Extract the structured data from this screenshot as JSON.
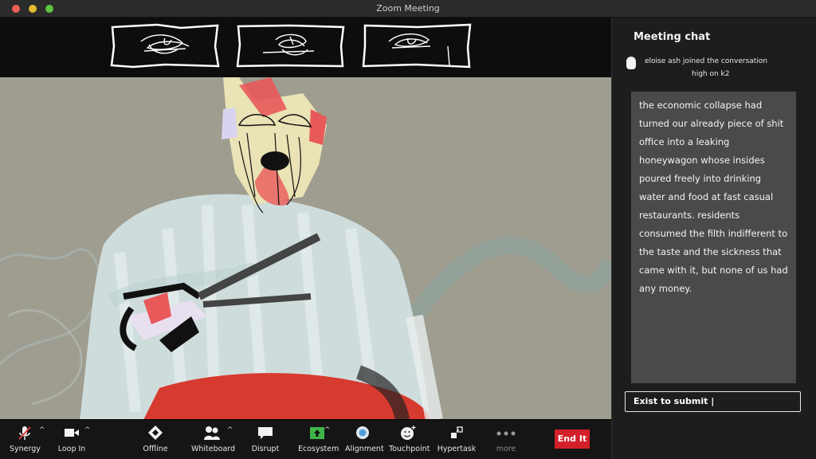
{
  "window": {
    "title": "Zoom Meeting"
  },
  "chat": {
    "title": "Meeting chat",
    "join_line": "eloise ash  joined the conversation",
    "join_sub": "high on k2",
    "message": "the economic collapse had turned our already piece of shit office into a leaking honeywagon whose insides poured freely into drinking water and food at fast casual restaurants. residents consumed the filth indifferent to the taste and the sickness that came with it, but none of us had any money.",
    "input_value": "Exist to submit |"
  },
  "toolbar": {
    "items": [
      {
        "label": "Synergy",
        "icon": "microphone-icon"
      },
      {
        "label": "Loop In",
        "icon": "video-camera-icon"
      },
      {
        "label": "Offline",
        "icon": "shield-icon"
      },
      {
        "label": "Whiteboard",
        "icon": "participants-icon"
      },
      {
        "label": "Disrupt",
        "icon": "chat-bubble-icon"
      },
      {
        "label": "Ecosystem",
        "icon": "share-screen-icon"
      },
      {
        "label": "Alignment",
        "icon": "record-icon"
      },
      {
        "label": "Touchpoint",
        "icon": "reaction-icon"
      },
      {
        "label": "Hypertask",
        "icon": "apps-icon"
      },
      {
        "label": "more",
        "icon": "more-icon"
      }
    ],
    "end_label": "End It"
  },
  "colors": {
    "end_button": "#d4202a",
    "video_bg": "#9e9d8f",
    "sidebar_bg": "#1d1d1d",
    "message_bg": "#4a4a4a"
  }
}
